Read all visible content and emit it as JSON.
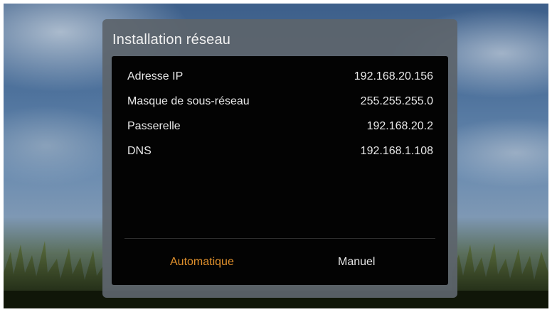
{
  "dialog": {
    "title": "Installation réseau",
    "fields": [
      {
        "label": "Adresse IP",
        "value": "192.168.20.156"
      },
      {
        "label": "Masque de sous-réseau",
        "value": "255.255.255.0"
      },
      {
        "label": "Passerelle",
        "value": "192.168.20.2"
      },
      {
        "label": "DNS",
        "value": "192.168.1.108"
      }
    ],
    "buttons": {
      "automatic": "Automatique",
      "manual": "Manuel"
    }
  },
  "colors": {
    "focused_button": "#e0902c",
    "dialog_frame": "#5c646c",
    "panel": "#030303"
  }
}
